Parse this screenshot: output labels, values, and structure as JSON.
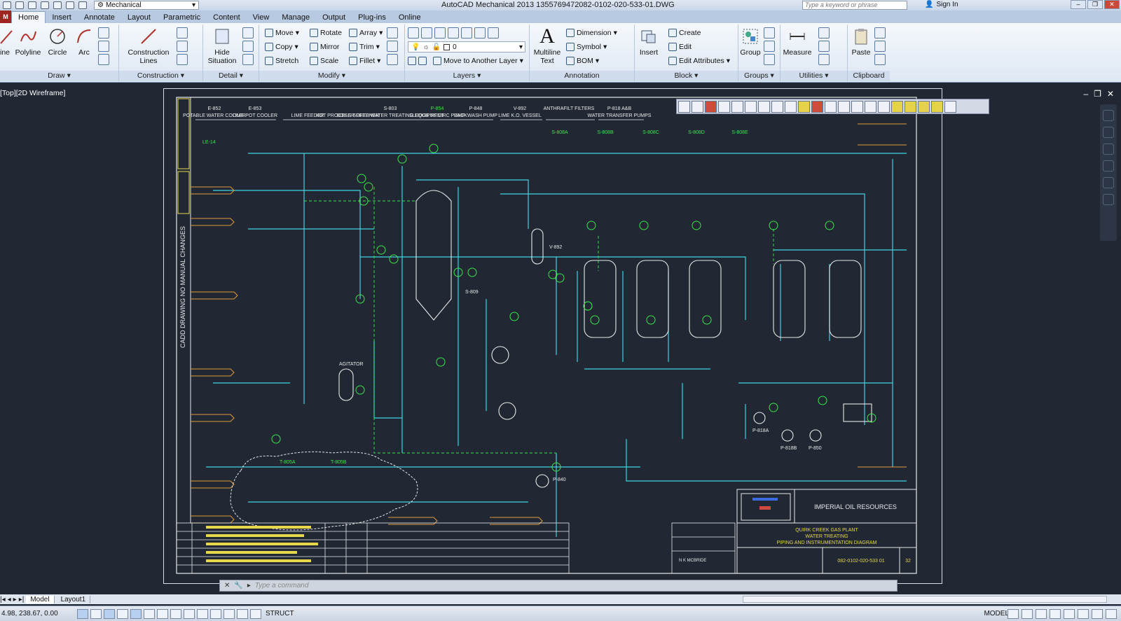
{
  "titlebar": {
    "workspace": "Mechanical",
    "app_title": "AutoCAD Mechanical 2013   1355769472082-0102-020-533-01.DWG",
    "search_placeholder": "Type a keyword or phrase",
    "signin": "Sign In"
  },
  "menu": {
    "app_button": "M",
    "tabs": [
      "Home",
      "Insert",
      "Annotate",
      "Layout",
      "Parametric",
      "Content",
      "View",
      "Manage",
      "Output",
      "Plug-ins",
      "Online"
    ]
  },
  "ribbon": {
    "draw": {
      "title": "Draw",
      "line": "ine",
      "polyline": "Polyline",
      "circle": "Circle",
      "arc": "Arc"
    },
    "construction": {
      "title": "Construction",
      "lines": "Construction\nLines"
    },
    "detail": {
      "title": "Detail",
      "hide": "Hide\nSituation"
    },
    "modify": {
      "title": "Modify",
      "move": "Move",
      "rotate": "Rotate",
      "array": "Array",
      "copy": "Copy",
      "mirror": "Mirror",
      "trim": "Trim",
      "stretch": "Stretch",
      "scale": "Scale",
      "fillet": "Fillet"
    },
    "layers": {
      "title": "Layers",
      "current_layer": "0",
      "move_to_layer": "Move to Another Layer"
    },
    "annotation": {
      "title": "Annotation",
      "mtext": "Multiline\nText",
      "dimension": "Dimension",
      "symbol": "Symbol",
      "bom": "BOM"
    },
    "block": {
      "title": "Block",
      "insert": "Insert",
      "create": "Create",
      "edit": "Edit",
      "edit_attr": "Edit Attributes"
    },
    "groups": {
      "title": "Groups",
      "group": "Group"
    },
    "utilities": {
      "title": "Utilities",
      "measure": "Measure"
    },
    "clipboard": {
      "title": "Clipboard",
      "paste": "Paste"
    }
  },
  "viewport": {
    "label": "[Top][2D Wireframe]"
  },
  "drawing": {
    "side_note": "CADD DRAWING NO MANUAL CHANGES",
    "title_company": "IMPERIAL OIL RESOURCES",
    "title_lines": [
      "QUIRK CREEK GAS PLANT",
      "WATER TREATING",
      "PIPING AND INSTRUMENTATION DIAGRAM"
    ],
    "drawing_number": "082-0102-020-533 01",
    "sheet_rev": "32",
    "drawn_by": "N K MCBRIDE",
    "header_tags": [
      {
        "tag": "E-852",
        "desc": "POTABLE WATER COOLER"
      },
      {
        "tag": "E-853",
        "desc": "LIME POT COOLER"
      },
      {
        "tag": "",
        "desc": "LIME FEEDER"
      },
      {
        "tag": "",
        "desc": "HOT PROCESS SOFTENER"
      },
      {
        "tag": "S-803",
        "desc": "BOILER FEED WATER TREATING EQUIPMENT"
      },
      {
        "tag": "P-854",
        "desc": "SLUDGE RECIRC PUMP"
      },
      {
        "tag": "P-848",
        "desc": "BACKWASH PUMP"
      },
      {
        "tag": "V-892",
        "desc": "LIME K.O. VESSEL"
      },
      {
        "tag": "",
        "desc": "ANTHRAFILT FILTERS"
      },
      {
        "tag": "P-818 A&B",
        "desc": "WATER TRANSFER PUMPS"
      }
    ],
    "vessels": [
      "S-808A",
      "S-808B",
      "S-808C",
      "S-808D",
      "S-808E"
    ],
    "labels": {
      "lime_pot": "LE-14",
      "v892": "V-892",
      "s809": "S-809",
      "p840": "P-840",
      "p818a": "P-818A",
      "p818b": "P-818B",
      "p850": "P-850",
      "t805a": "T-805A",
      "t805b": "T-805B",
      "agitator": "AGITATOR"
    }
  },
  "command": {
    "placeholder": "Type a command"
  },
  "layout_tabs": [
    "Model",
    "Layout1"
  ],
  "status": {
    "coords": "4.98, 238.67, 0.00",
    "struct": "STRUCT",
    "model": "MODEL"
  },
  "colors": {
    "cad_bg": "#212834",
    "cyan": "#3fd3e0",
    "green": "#39e64a",
    "yellow": "#e6d84a",
    "orange": "#e09a3a",
    "white": "#e8e8e8"
  }
}
